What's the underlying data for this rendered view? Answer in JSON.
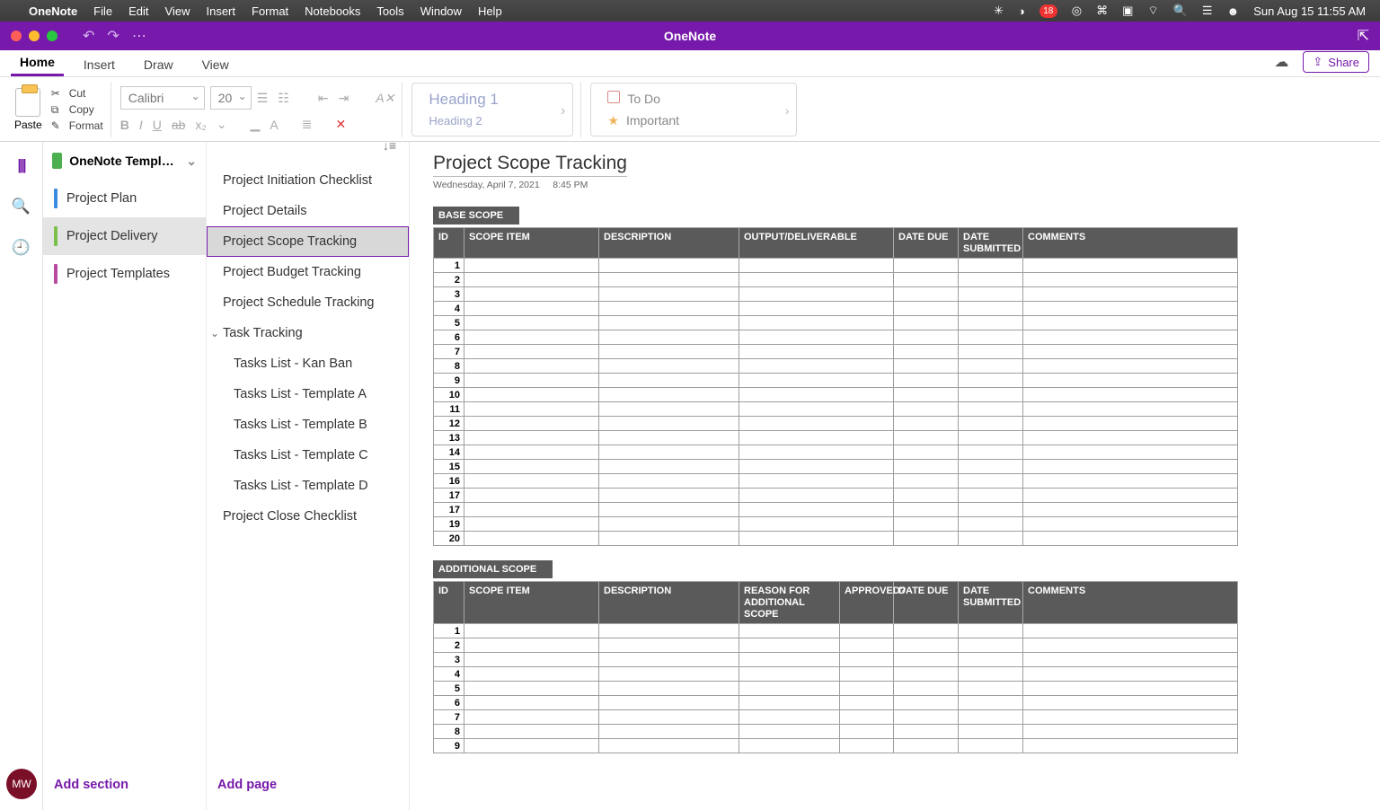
{
  "menubar": {
    "app": "OneNote",
    "items": [
      "File",
      "Edit",
      "View",
      "Insert",
      "Format",
      "Notebooks",
      "Tools",
      "Window",
      "Help"
    ],
    "right_badge": "18",
    "datetime": "Sun Aug 15  11:55 AM"
  },
  "titlebar": {
    "app_center": "OneNote"
  },
  "ribbon_tabs": [
    "Home",
    "Insert",
    "Draw",
    "View"
  ],
  "share_label": "Share",
  "ribbon": {
    "paste": "Paste",
    "cut": "Cut",
    "copy": "Copy",
    "format": "Format",
    "font_name": "Calibri",
    "font_size": "20",
    "style1": "Heading 1",
    "style2": "Heading 2",
    "tag1": "To Do",
    "tag2": "Important"
  },
  "notebook": {
    "title": "OneNote Template for Project Management",
    "sections": [
      {
        "label": "Project Plan",
        "color": "#3a8dde"
      },
      {
        "label": "Project Delivery",
        "color": "#7cc04b"
      },
      {
        "label": "Project Templates",
        "color": "#b84aa0"
      }
    ],
    "add_section": "Add section"
  },
  "pages": {
    "sort_icon": "↓≡",
    "items": [
      {
        "label": "Project Initiation Checklist"
      },
      {
        "label": "Project Details"
      },
      {
        "label": "Project Scope Tracking",
        "selected": true
      },
      {
        "label": "Project Budget Tracking"
      },
      {
        "label": "Project Schedule Tracking"
      },
      {
        "label": "Task Tracking",
        "caret": true
      },
      {
        "label": "Tasks List - Kan Ban",
        "sub": true
      },
      {
        "label": "Tasks List - Template A",
        "sub": true
      },
      {
        "label": "Tasks List - Template B",
        "sub": true
      },
      {
        "label": "Tasks List - Template C",
        "sub": true
      },
      {
        "label": "Tasks List - Template D",
        "sub": true
      },
      {
        "label": "Project Close Checklist"
      }
    ],
    "add_page": "Add page"
  },
  "note": {
    "title": "Project Scope Tracking",
    "date": "Wednesday, April 7, 2021",
    "time": "8:45 PM",
    "base_scope_label": "BASE SCOPE",
    "additional_scope_label": "ADDITIONAL SCOPE",
    "table1": {
      "headers": [
        "ID",
        "SCOPE ITEM",
        "DESCRIPTION",
        "OUTPUT/DELIVERABLE",
        "DATE DUE",
        "DATE SUBMITTED",
        "COMMENTS"
      ],
      "row_ids": [
        "1",
        "2",
        "3",
        "4",
        "5",
        "6",
        "7",
        "8",
        "9",
        "10",
        "11",
        "12",
        "13",
        "14",
        "15",
        "16",
        "17",
        "17",
        "19",
        "20"
      ]
    },
    "table2": {
      "headers": [
        "ID",
        "SCOPE ITEM",
        "DESCRIPTION",
        "REASON FOR ADDITIONAL SCOPE",
        "APPROVED?",
        "DATE DUE",
        "DATE SUBMITTED",
        "COMMENTS"
      ],
      "row_ids": [
        "1",
        "2",
        "3",
        "4",
        "5",
        "6",
        "7",
        "8",
        "9"
      ]
    }
  },
  "avatar_initials": "MW"
}
